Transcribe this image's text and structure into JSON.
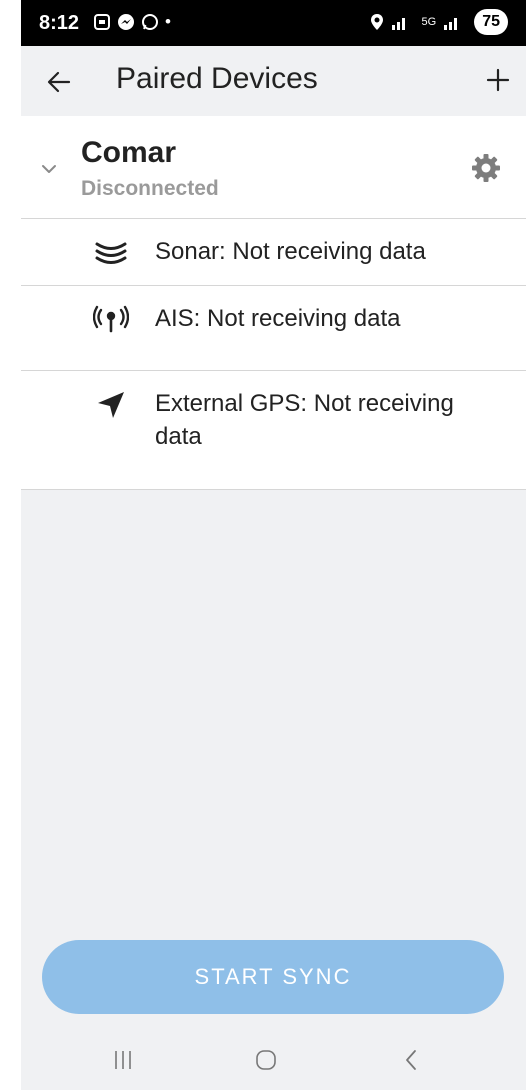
{
  "status_bar": {
    "time": "8:12",
    "left_icons": [
      "screenshot-icon",
      "messenger-icon",
      "whatsapp-icon",
      "dot-icon"
    ],
    "network_5g": "5G",
    "battery": "75"
  },
  "header": {
    "title": "Paired Devices"
  },
  "device": {
    "name": "Comar",
    "status": "Disconnected"
  },
  "features": [
    {
      "icon": "sonar-icon",
      "label": "Sonar: Not receiving data"
    },
    {
      "icon": "ais-icon",
      "label": "AIS: Not receiving data"
    },
    {
      "icon": "gps-arrow-icon",
      "label": "External GPS: Not receiving data"
    }
  ],
  "actions": {
    "start_sync_label": "START SYNC"
  },
  "colors": {
    "accent": "#8fbfe8",
    "background": "#f0f1f3",
    "muted_text": "#9a9a9a"
  }
}
